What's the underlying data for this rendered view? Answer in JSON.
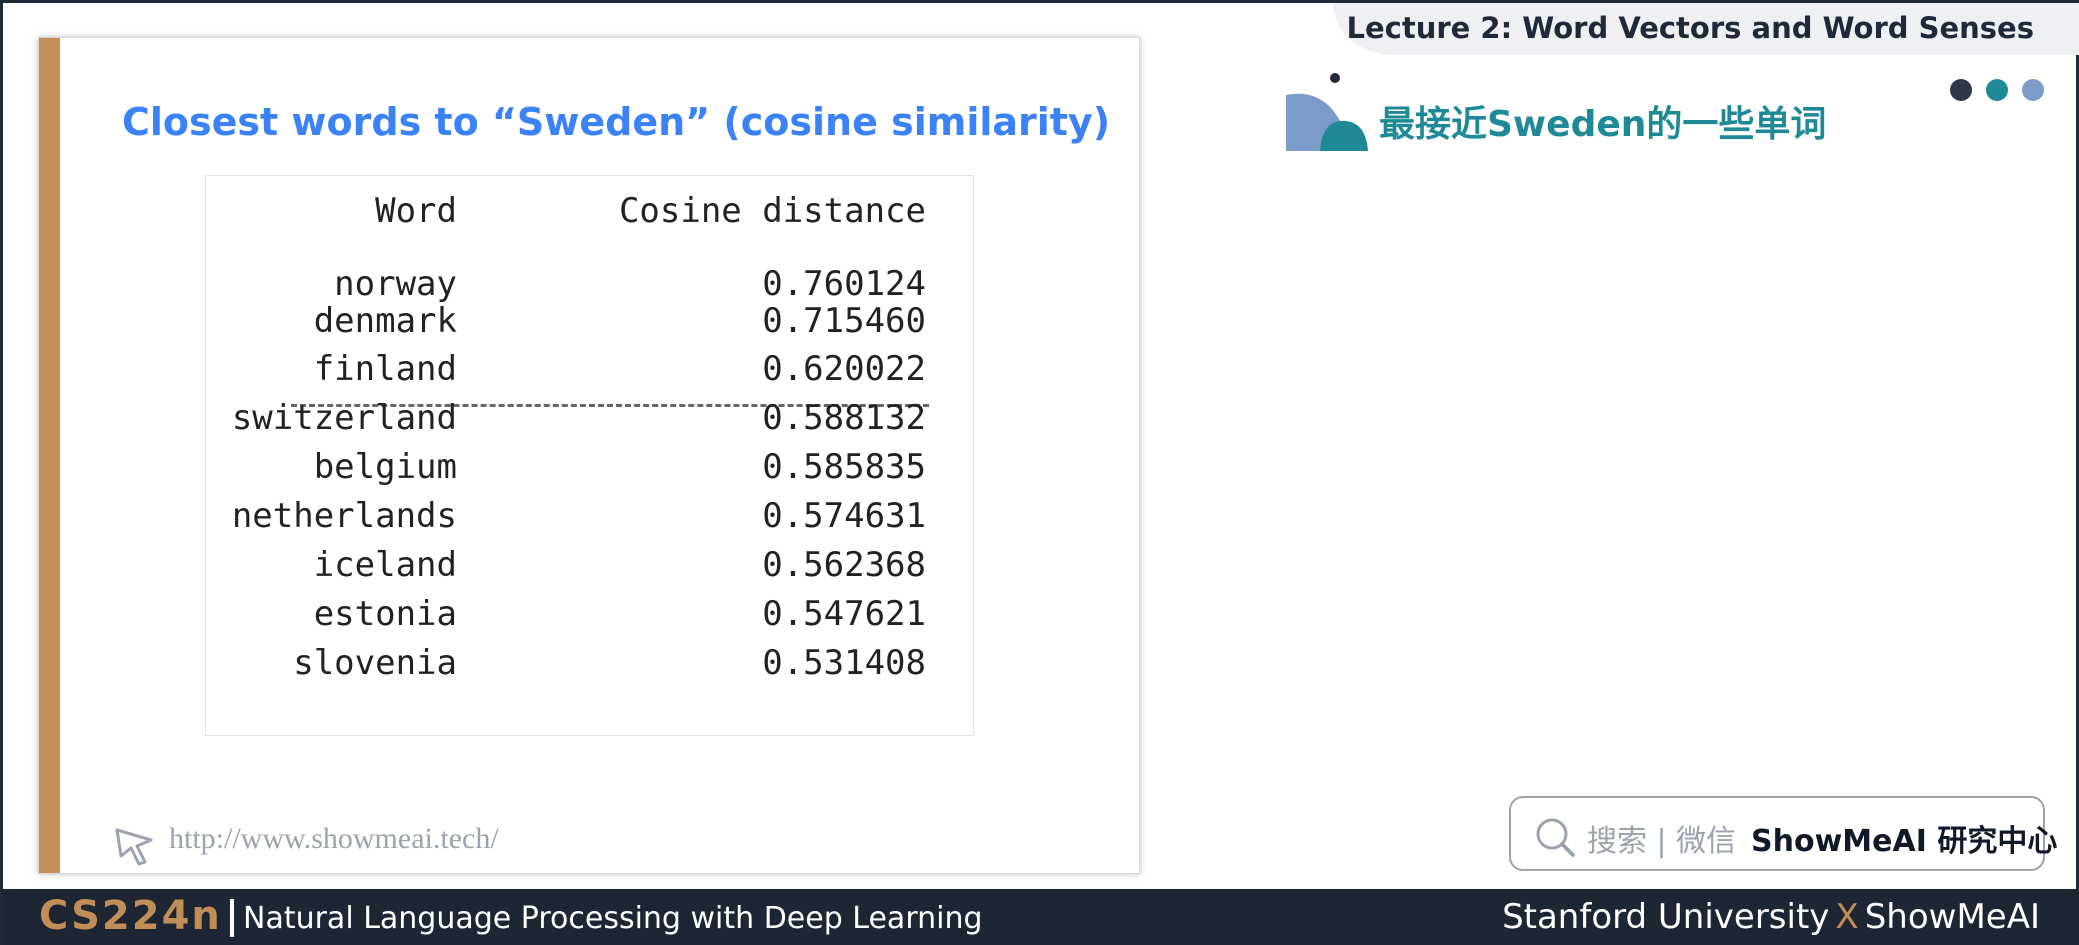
{
  "header": {
    "lecture_title": "Lecture 2:  Word Vectors and Word Senses"
  },
  "slide": {
    "title": "Closest words to “Sweden” (cosine similarity)",
    "table": {
      "headers": {
        "word": "Word",
        "value": "Cosine distance"
      },
      "rows": [
        {
          "word": "norway",
          "value": "0.760124"
        },
        {
          "word": "denmark",
          "value": "0.715460"
        },
        {
          "word": "finland",
          "value": "0.620022"
        },
        {
          "word": "switzerland",
          "value": "0.588132"
        },
        {
          "word": "belgium",
          "value": "0.585835"
        },
        {
          "word": "netherlands",
          "value": "0.574631"
        },
        {
          "word": "iceland",
          "value": "0.562368"
        },
        {
          "word": "estonia",
          "value": "0.547621"
        },
        {
          "word": "slovenia",
          "value": "0.531408"
        }
      ]
    },
    "url": "http://www.showmeai.tech/"
  },
  "section": {
    "heading": "最接近Sweden的一些单词",
    "dots_colors": [
      "#2d3748",
      "#1f8a95",
      "#7b9cc9"
    ]
  },
  "search": {
    "hint": "搜索 | 微信",
    "brand": "ShowMeAI 研究中心"
  },
  "footer": {
    "course_code": "CS224n",
    "course_name": "Natural Language Processing with Deep Learning",
    "credit_left": "Stanford University",
    "credit_x": "X",
    "credit_right": "ShowMeAI"
  },
  "colors": {
    "accent_gold": "#c08e56",
    "title_blue": "#3b82f6",
    "teal": "#1f8a95",
    "footer_bg": "#1e2533"
  }
}
